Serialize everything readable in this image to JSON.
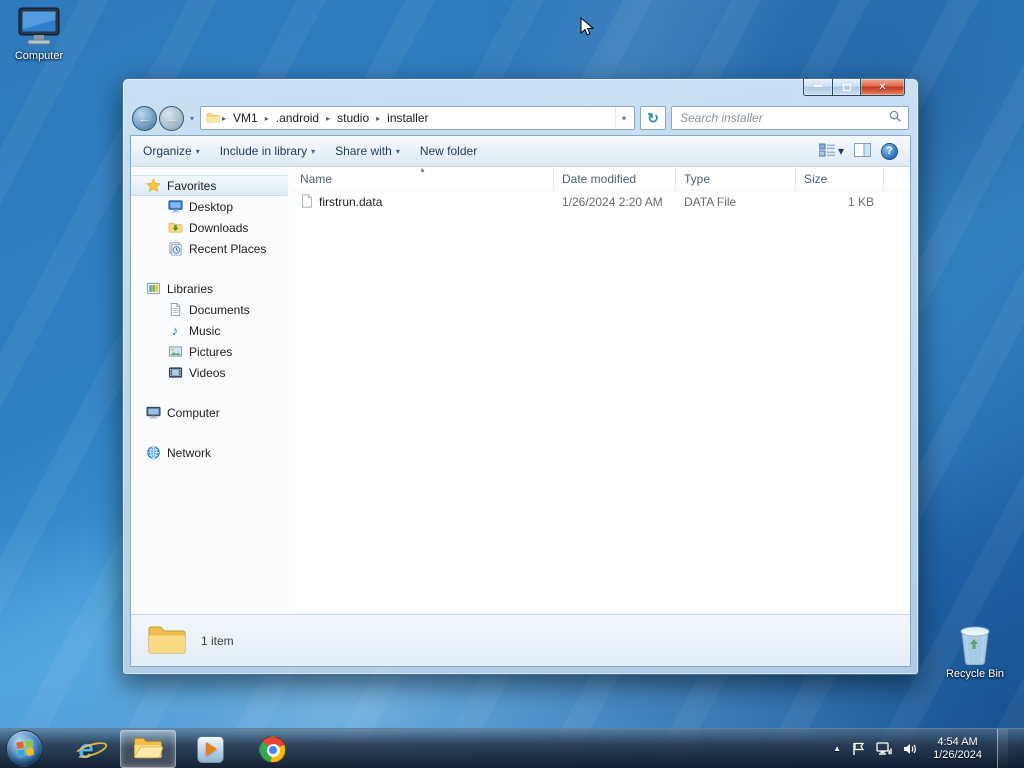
{
  "desktop": {
    "computer_label": "Computer",
    "recycle_bin_label": "Recycle Bin"
  },
  "explorer": {
    "nav": {
      "breadcrumb": [
        "VM1",
        ".android",
        "studio",
        "installer"
      ],
      "search_placeholder": "Search installer"
    },
    "toolbar": {
      "organize": "Organize",
      "include_in_library": "Include in library",
      "share_with": "Share with",
      "new_folder": "New folder"
    },
    "sidebar": {
      "favorites": "Favorites",
      "favorites_items": [
        "Desktop",
        "Downloads",
        "Recent Places"
      ],
      "libraries": "Libraries",
      "libraries_items": [
        "Documents",
        "Music",
        "Pictures",
        "Videos"
      ],
      "computer": "Computer",
      "network": "Network"
    },
    "columns": [
      "Name",
      "Date modified",
      "Type",
      "Size"
    ],
    "files": [
      {
        "name": "firstrun.data",
        "date_modified": "1/26/2024 2:20 AM",
        "type": "DATA File",
        "size": "1 KB"
      }
    ],
    "details": {
      "item_count": "1 item"
    }
  },
  "taskbar": {
    "clock_time": "4:54 AM",
    "clock_date": "1/26/2024"
  },
  "icons": {
    "dropdown_arrow": "▾",
    "breadcrumb_separator": "▸",
    "sort_arrow": "▴",
    "back_arrow": "←",
    "forward_arrow": "→",
    "refresh": "↻",
    "help": "?",
    "close": "✕",
    "tray_expand": "▲",
    "music_note": "♪",
    "ie_letter": "e"
  },
  "colors": {
    "accent_blue": "#2a6db5",
    "folder_yellow": "#f7cf6b",
    "close_red": "#c1351f"
  }
}
